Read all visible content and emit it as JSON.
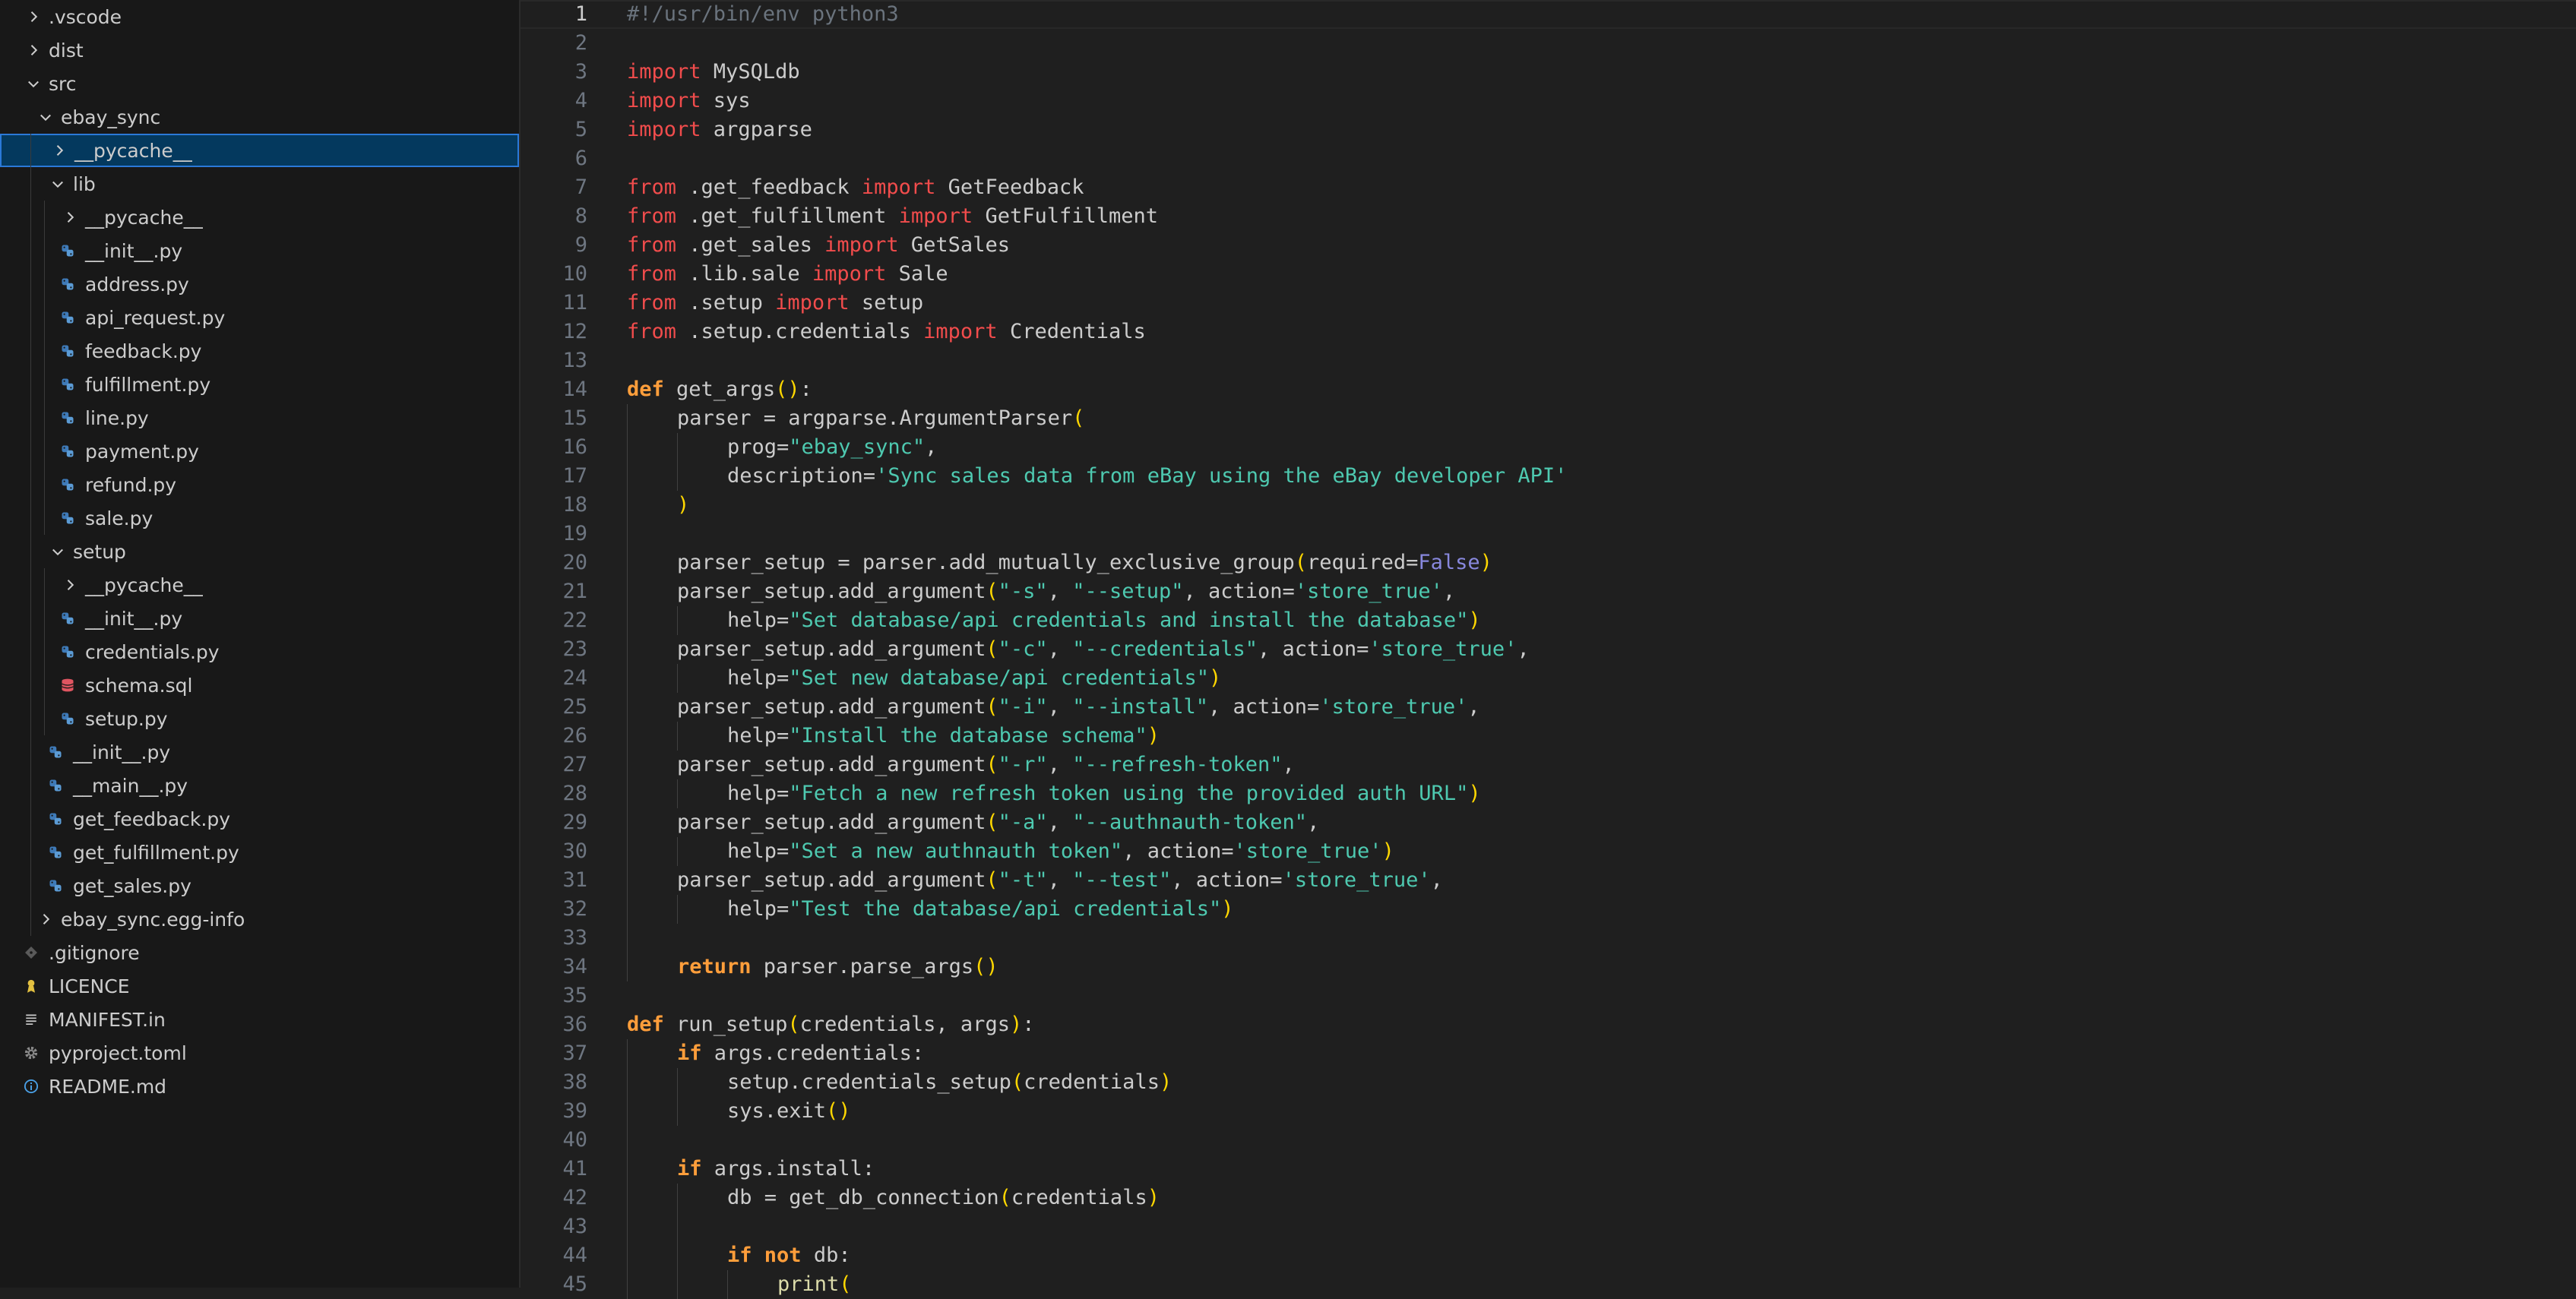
{
  "explorer": {
    "items": [
      {
        "label": ".vscode",
        "type": "folder",
        "expanded": false,
        "depth": 1
      },
      {
        "label": "dist",
        "type": "folder",
        "expanded": false,
        "depth": 1
      },
      {
        "label": "src",
        "type": "folder",
        "expanded": true,
        "depth": 1
      },
      {
        "label": "ebay_sync",
        "type": "folder",
        "expanded": true,
        "depth": 2
      },
      {
        "label": "__pycache__",
        "type": "folder",
        "expanded": false,
        "depth": 3,
        "selected": true
      },
      {
        "label": "lib",
        "type": "folder",
        "expanded": true,
        "depth": 3
      },
      {
        "label": "__pycache__",
        "type": "folder",
        "expanded": false,
        "depth": 4
      },
      {
        "label": "__init__.py",
        "type": "python",
        "depth": 4
      },
      {
        "label": "address.py",
        "type": "python",
        "depth": 4
      },
      {
        "label": "api_request.py",
        "type": "python",
        "depth": 4
      },
      {
        "label": "feedback.py",
        "type": "python",
        "depth": 4
      },
      {
        "label": "fulfillment.py",
        "type": "python",
        "depth": 4
      },
      {
        "label": "line.py",
        "type": "python",
        "depth": 4
      },
      {
        "label": "payment.py",
        "type": "python",
        "depth": 4
      },
      {
        "label": "refund.py",
        "type": "python",
        "depth": 4
      },
      {
        "label": "sale.py",
        "type": "python",
        "depth": 4
      },
      {
        "label": "setup",
        "type": "folder",
        "expanded": true,
        "depth": 3
      },
      {
        "label": "__pycache__",
        "type": "folder",
        "expanded": false,
        "depth": 4
      },
      {
        "label": "__init__.py",
        "type": "python",
        "depth": 4
      },
      {
        "label": "credentials.py",
        "type": "python",
        "depth": 4
      },
      {
        "label": "schema.sql",
        "type": "sql",
        "depth": 4
      },
      {
        "label": "setup.py",
        "type": "python",
        "depth": 4
      },
      {
        "label": "__init__.py",
        "type": "python",
        "depth": 3
      },
      {
        "label": "__main__.py",
        "type": "python",
        "depth": 3
      },
      {
        "label": "get_feedback.py",
        "type": "python",
        "depth": 3
      },
      {
        "label": "get_fulfillment.py",
        "type": "python",
        "depth": 3
      },
      {
        "label": "get_sales.py",
        "type": "python",
        "depth": 3
      },
      {
        "label": "ebay_sync.egg-info",
        "type": "folder",
        "expanded": false,
        "depth": 2
      },
      {
        "label": ".gitignore",
        "type": "git",
        "depth": 1
      },
      {
        "label": "LICENCE",
        "type": "licence",
        "depth": 1
      },
      {
        "label": "MANIFEST.in",
        "type": "text",
        "depth": 1
      },
      {
        "label": "pyproject.toml",
        "type": "config",
        "depth": 1
      },
      {
        "label": "README.md",
        "type": "info",
        "depth": 1
      }
    ]
  },
  "editor": {
    "active_line": 1,
    "lines": [
      {
        "n": "1",
        "indent": 0,
        "tokens": [
          [
            "c",
            "#!/usr/bin/env python3"
          ]
        ]
      },
      {
        "n": "2",
        "indent": 0,
        "tokens": []
      },
      {
        "n": "3",
        "indent": 0,
        "tokens": [
          [
            "k",
            "import"
          ],
          [
            "",
            " MySQLdb"
          ]
        ]
      },
      {
        "n": "4",
        "indent": 0,
        "tokens": [
          [
            "k",
            "import"
          ],
          [
            "",
            " sys"
          ]
        ]
      },
      {
        "n": "5",
        "indent": 0,
        "tokens": [
          [
            "k",
            "import"
          ],
          [
            "",
            " argparse"
          ]
        ]
      },
      {
        "n": "6",
        "indent": 0,
        "tokens": []
      },
      {
        "n": "7",
        "indent": 0,
        "tokens": [
          [
            "k",
            "from"
          ],
          [
            "",
            " .get_feedback "
          ],
          [
            "k",
            "import"
          ],
          [
            "",
            " GetFeedback"
          ]
        ]
      },
      {
        "n": "8",
        "indent": 0,
        "tokens": [
          [
            "k",
            "from"
          ],
          [
            "",
            " .get_fulfillment "
          ],
          [
            "k",
            "import"
          ],
          [
            "",
            " GetFulfillment"
          ]
        ]
      },
      {
        "n": "9",
        "indent": 0,
        "tokens": [
          [
            "k",
            "from"
          ],
          [
            "",
            " .get_sales "
          ],
          [
            "k",
            "import"
          ],
          [
            "",
            " GetSales"
          ]
        ]
      },
      {
        "n": "10",
        "indent": 0,
        "tokens": [
          [
            "k",
            "from"
          ],
          [
            "",
            " .lib.sale "
          ],
          [
            "k",
            "import"
          ],
          [
            "",
            " Sale"
          ]
        ]
      },
      {
        "n": "11",
        "indent": 0,
        "tokens": [
          [
            "k",
            "from"
          ],
          [
            "",
            " .setup "
          ],
          [
            "k",
            "import"
          ],
          [
            "",
            " setup"
          ]
        ]
      },
      {
        "n": "12",
        "indent": 0,
        "tokens": [
          [
            "k",
            "from"
          ],
          [
            "",
            " .setup.credentials "
          ],
          [
            "k",
            "import"
          ],
          [
            "",
            " Credentials"
          ]
        ]
      },
      {
        "n": "13",
        "indent": 0,
        "tokens": []
      },
      {
        "n": "14",
        "indent": 0,
        "tokens": [
          [
            "kd",
            "def"
          ],
          [
            "",
            " get_args"
          ],
          [
            "p",
            "()"
          ],
          [
            "",
            ":"
          ]
        ]
      },
      {
        "n": "15",
        "indent": 1,
        "tokens": [
          [
            "",
            "parser = argparse.ArgumentParser"
          ],
          [
            "p",
            "("
          ]
        ]
      },
      {
        "n": "16",
        "indent": 2,
        "tokens": [
          [
            "",
            "prog="
          ],
          [
            "s",
            "\"ebay_sync\""
          ],
          [
            "",
            ","
          ]
        ]
      },
      {
        "n": "17",
        "indent": 2,
        "tokens": [
          [
            "",
            "description="
          ],
          [
            "s",
            "'Sync sales data from eBay using the eBay developer API'"
          ]
        ]
      },
      {
        "n": "18",
        "indent": 1,
        "tokens": [
          [
            "p",
            ")"
          ]
        ]
      },
      {
        "n": "19",
        "indent": 1,
        "tokens": []
      },
      {
        "n": "20",
        "indent": 1,
        "tokens": [
          [
            "",
            "parser_setup = parser.add_mutually_exclusive_group"
          ],
          [
            "p",
            "("
          ],
          [
            "",
            "required="
          ],
          [
            "b",
            "False"
          ],
          [
            "p",
            ")"
          ]
        ]
      },
      {
        "n": "21",
        "indent": 1,
        "tokens": [
          [
            "",
            "parser_setup.add_argument"
          ],
          [
            "p",
            "("
          ],
          [
            "s",
            "\"-s\""
          ],
          [
            "",
            ", "
          ],
          [
            "s",
            "\"--setup\""
          ],
          [
            "",
            ", action="
          ],
          [
            "s",
            "'store_true'"
          ],
          [
            "",
            ","
          ]
        ]
      },
      {
        "n": "22",
        "indent": 2,
        "tokens": [
          [
            "",
            "help="
          ],
          [
            "s",
            "\"Set database/api credentials and install the database\""
          ],
          [
            "p",
            ")"
          ]
        ]
      },
      {
        "n": "23",
        "indent": 1,
        "tokens": [
          [
            "",
            "parser_setup.add_argument"
          ],
          [
            "p",
            "("
          ],
          [
            "s",
            "\"-c\""
          ],
          [
            "",
            ", "
          ],
          [
            "s",
            "\"--credentials\""
          ],
          [
            "",
            ", action="
          ],
          [
            "s",
            "'store_true'"
          ],
          [
            "",
            ","
          ]
        ]
      },
      {
        "n": "24",
        "indent": 2,
        "tokens": [
          [
            "",
            "help="
          ],
          [
            "s",
            "\"Set new database/api credentials\""
          ],
          [
            "p",
            ")"
          ]
        ]
      },
      {
        "n": "25",
        "indent": 1,
        "tokens": [
          [
            "",
            "parser_setup.add_argument"
          ],
          [
            "p",
            "("
          ],
          [
            "s",
            "\"-i\""
          ],
          [
            "",
            ", "
          ],
          [
            "s",
            "\"--install\""
          ],
          [
            "",
            ", action="
          ],
          [
            "s",
            "'store_true'"
          ],
          [
            "",
            ","
          ]
        ]
      },
      {
        "n": "26",
        "indent": 2,
        "tokens": [
          [
            "",
            "help="
          ],
          [
            "s",
            "\"Install the database schema\""
          ],
          [
            "p",
            ")"
          ]
        ]
      },
      {
        "n": "27",
        "indent": 1,
        "tokens": [
          [
            "",
            "parser_setup.add_argument"
          ],
          [
            "p",
            "("
          ],
          [
            "s",
            "\"-r\""
          ],
          [
            "",
            ", "
          ],
          [
            "s",
            "\"--refresh-token\""
          ],
          [
            "",
            ","
          ]
        ]
      },
      {
        "n": "28",
        "indent": 2,
        "tokens": [
          [
            "",
            "help="
          ],
          [
            "s",
            "\"Fetch a new refresh token using the provided auth URL\""
          ],
          [
            "p",
            ")"
          ]
        ]
      },
      {
        "n": "29",
        "indent": 1,
        "tokens": [
          [
            "",
            "parser_setup.add_argument"
          ],
          [
            "p",
            "("
          ],
          [
            "s",
            "\"-a\""
          ],
          [
            "",
            ", "
          ],
          [
            "s",
            "\"--authnauth-token\""
          ],
          [
            "",
            ","
          ]
        ]
      },
      {
        "n": "30",
        "indent": 2,
        "tokens": [
          [
            "",
            "help="
          ],
          [
            "s",
            "\"Set a new authnauth token\""
          ],
          [
            "",
            ", action="
          ],
          [
            "s",
            "'store_true'"
          ],
          [
            "p",
            ")"
          ]
        ]
      },
      {
        "n": "31",
        "indent": 1,
        "tokens": [
          [
            "",
            "parser_setup.add_argument"
          ],
          [
            "p",
            "("
          ],
          [
            "s",
            "\"-t\""
          ],
          [
            "",
            ", "
          ],
          [
            "s",
            "\"--test\""
          ],
          [
            "",
            ", action="
          ],
          [
            "s",
            "'store_true'"
          ],
          [
            "",
            ","
          ]
        ]
      },
      {
        "n": "32",
        "indent": 2,
        "tokens": [
          [
            "",
            "help="
          ],
          [
            "s",
            "\"Test the database/api credentials\""
          ],
          [
            "p",
            ")"
          ]
        ]
      },
      {
        "n": "33",
        "indent": 1,
        "tokens": []
      },
      {
        "n": "34",
        "indent": 1,
        "tokens": [
          [
            "kd",
            "return"
          ],
          [
            "",
            " parser.parse_args"
          ],
          [
            "p",
            "()"
          ]
        ]
      },
      {
        "n": "35",
        "indent": 0,
        "tokens": []
      },
      {
        "n": "36",
        "indent": 0,
        "tokens": [
          [
            "kd",
            "def"
          ],
          [
            "",
            " run_setup"
          ],
          [
            "p",
            "("
          ],
          [
            "",
            "credentials, args"
          ],
          [
            "p",
            ")"
          ],
          [
            "",
            ":"
          ]
        ]
      },
      {
        "n": "37",
        "indent": 1,
        "tokens": [
          [
            "kd",
            "if"
          ],
          [
            "",
            " args.credentials:"
          ]
        ]
      },
      {
        "n": "38",
        "indent": 2,
        "tokens": [
          [
            "",
            "setup.credentials_setup"
          ],
          [
            "p",
            "("
          ],
          [
            "",
            "credentials"
          ],
          [
            "p",
            ")"
          ]
        ]
      },
      {
        "n": "39",
        "indent": 2,
        "tokens": [
          [
            "",
            "sys.exit"
          ],
          [
            "p",
            "()"
          ]
        ]
      },
      {
        "n": "40",
        "indent": 1,
        "tokens": []
      },
      {
        "n": "41",
        "indent": 1,
        "tokens": [
          [
            "kd",
            "if"
          ],
          [
            "",
            " args.install:"
          ]
        ]
      },
      {
        "n": "42",
        "indent": 2,
        "tokens": [
          [
            "",
            "db = get_db_connection"
          ],
          [
            "p",
            "("
          ],
          [
            "",
            "credentials"
          ],
          [
            "p",
            ")"
          ]
        ]
      },
      {
        "n": "43",
        "indent": 2,
        "tokens": []
      },
      {
        "n": "44",
        "indent": 2,
        "tokens": [
          [
            "kd",
            "if"
          ],
          [
            "",
            " "
          ],
          [
            "kd",
            "not"
          ],
          [
            "",
            " db:"
          ]
        ]
      },
      {
        "n": "45",
        "indent": 3,
        "tokens": [
          [
            "fn",
            "print"
          ],
          [
            "p",
            "("
          ]
        ]
      }
    ]
  }
}
